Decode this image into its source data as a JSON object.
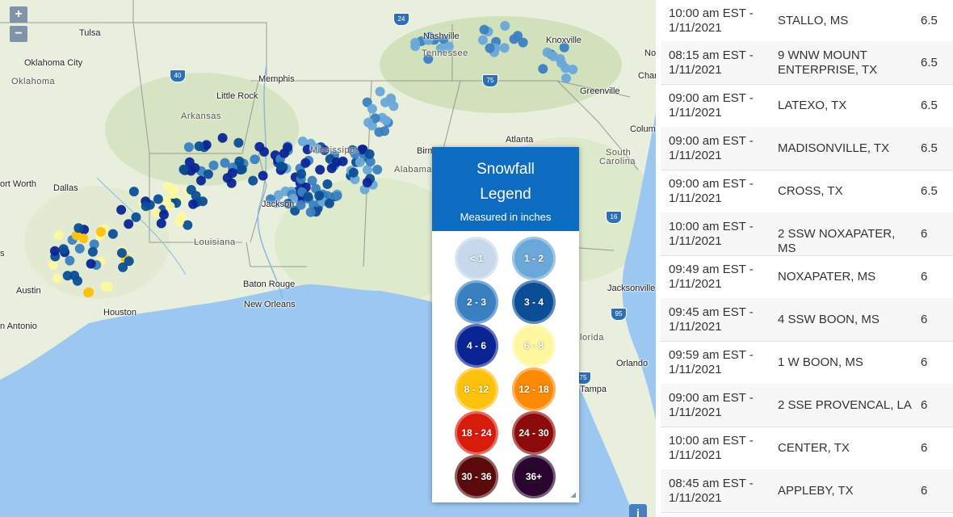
{
  "map": {
    "zoom_in_label": "+",
    "zoom_out_label": "−",
    "info_label": "i",
    "cities": [
      "Tulsa",
      "Oklahoma City",
      "Oklahoma",
      "Memphis",
      "Little Rock",
      "Arkansas",
      "Nashville",
      "Tennessee",
      "Knoxville",
      "Greenville",
      "Columbia",
      "South Carolina",
      "Charlotte",
      "Atlanta",
      "Birmingham",
      "Alabama",
      "Mississippi",
      "Jackson",
      "Louisiana",
      "Baton Rouge",
      "New Orleans",
      "Dallas",
      "Fort Worth",
      "Austin",
      "Houston",
      "San Antonio",
      "Jacksonville",
      "Orlando",
      "Tampa",
      "Florida"
    ],
    "city_display": {
      "tulsa": "Tulsa",
      "okc": "Oklahoma City",
      "ok": "Oklahoma",
      "memphis": "Memphis",
      "littlerock": "Little Rock",
      "arkansas": "Arkansas",
      "nashville": "Nashville",
      "tennessee": "Tennessee",
      "knoxville": "Knoxville",
      "greenville": "Greenville",
      "columbia": "Colum",
      "sc": "South Carolina",
      "sc2": "South",
      "sc3": "Carolina",
      "charlotte": "Char",
      "atlanta": "Atlanta",
      "birmingham": "Birmi",
      "alabama": "Alabama",
      "mississippi": "Mississippi",
      "jackson": "Jackson",
      "louisiana": "Louisiana",
      "batonrouge": "Baton Rouge",
      "neworleans": "New Orleans",
      "dallas": "Dallas",
      "fortworth": "ort Worth",
      "austin": "Austin",
      "houston": "Houston",
      "sanantonio": "n Antonio",
      "jacksonville": "Jacksonville",
      "orlando": "Orlando",
      "tampa": "Tampa",
      "florida": "lorida",
      "s_edge": "s",
      "no": "No"
    },
    "highways": [
      "40",
      "40",
      "24",
      "75",
      "75",
      "16",
      "95",
      "75"
    ]
  },
  "legend": {
    "title_line1": "Snowfall",
    "title_line2": "Legend",
    "subtitle": "Measured in inches",
    "bins": [
      {
        "label": "< 1",
        "color": "#c6d9ea"
      },
      {
        "label": "1 - 2",
        "color": "#6aa8d8"
      },
      {
        "label": "2 - 3",
        "color": "#3a7fc0"
      },
      {
        "label": "3 - 4",
        "color": "#0b4e96"
      },
      {
        "label": "4 - 6",
        "color": "#0a2593"
      },
      {
        "label": "6 - 8",
        "color": "#fdf8a0"
      },
      {
        "label": "8 - 12",
        "color": "#fec10c"
      },
      {
        "label": "12 - 18",
        "color": "#fd8a05"
      },
      {
        "label": "18 - 24",
        "color": "#d81c0c"
      },
      {
        "label": "24 - 30",
        "color": "#8e0b0b"
      },
      {
        "label": "30 - 36",
        "color": "#5a0a0a"
      },
      {
        "label": "36+",
        "color": "#2a0530"
      }
    ]
  },
  "reports": [
    {
      "time": "10:00 am EST - 1/11/2021",
      "location": "STALLO, MS",
      "value": "6.5"
    },
    {
      "time": "08:15 am EST - 1/11/2021",
      "location": "9 WNW MOUNT ENTERPRISE, TX",
      "value": "6.5"
    },
    {
      "time": "09:00 am EST - 1/11/2021",
      "location": "LATEXO, TX",
      "value": "6.5"
    },
    {
      "time": "09:00 am EST - 1/11/2021",
      "location": "MADISONVILLE, TX",
      "value": "6.5"
    },
    {
      "time": "09:00 am EST - 1/11/2021",
      "location": "CROSS, TX",
      "value": "6.5"
    },
    {
      "time": "10:00 am EST - 1/11/2021",
      "location": "2 SSW NOXAPATER, MS",
      "value": "6"
    },
    {
      "time": "09:49 am EST - 1/11/2021",
      "location": "NOXAPATER, MS",
      "value": "6"
    },
    {
      "time": "09:45 am EST - 1/11/2021",
      "location": "4 SSW BOON, MS",
      "value": "6"
    },
    {
      "time": "09:59 am EST - 1/11/2021",
      "location": "1 W BOON, MS",
      "value": "6"
    },
    {
      "time": "09:00 am EST - 1/11/2021",
      "location": "2 SSE PROVENCAL, LA",
      "value": "6"
    },
    {
      "time": "10:00 am EST - 1/11/2021",
      "location": "CENTER, TX",
      "value": "6"
    },
    {
      "time": "08:45 am EST - 1/11/2021",
      "location": "APPLEBY, TX",
      "value": "6"
    }
  ]
}
